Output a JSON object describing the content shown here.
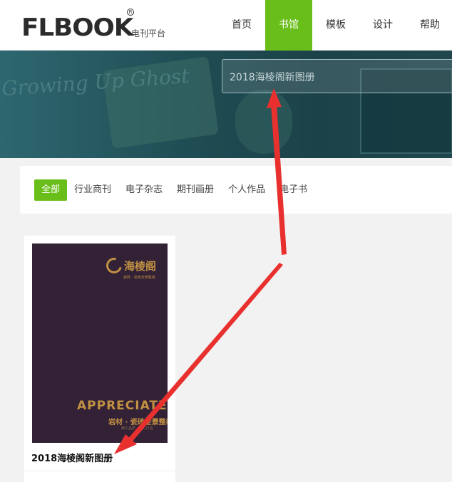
{
  "header": {
    "logo_text": "FLBOOK",
    "logo_reg": "R",
    "logo_sub": "电刊平台",
    "nav": [
      {
        "label": "首页",
        "active": false
      },
      {
        "label": "书馆",
        "active": true
      },
      {
        "label": "模板",
        "active": false
      },
      {
        "label": "设计",
        "active": false
      },
      {
        "label": "帮助",
        "active": false
      }
    ]
  },
  "banner": {
    "script_text": "Growing Up Ghost",
    "search_value": "2018海棱阁新图册"
  },
  "filters": [
    "全部",
    "行业商刊",
    "电子杂志",
    "期刊画册",
    "个人作品",
    "电子书"
  ],
  "card": {
    "title": "2018海棱阁新图册",
    "cover": {
      "brand": "海棱阁",
      "brand_sub": "瓷砖 · 岩板全景整装",
      "headline": "APPRECIATE",
      "subline": "岩材 · 瓷砖全景整装",
      "tiny": "精工品质 · 匠心打造"
    }
  },
  "colors": {
    "accent_green": "#6abe1a",
    "banner_teal": "#1f4b52",
    "cover_purple": "#332136",
    "gold": "#c19143",
    "arrow_red": "#e8312f"
  }
}
